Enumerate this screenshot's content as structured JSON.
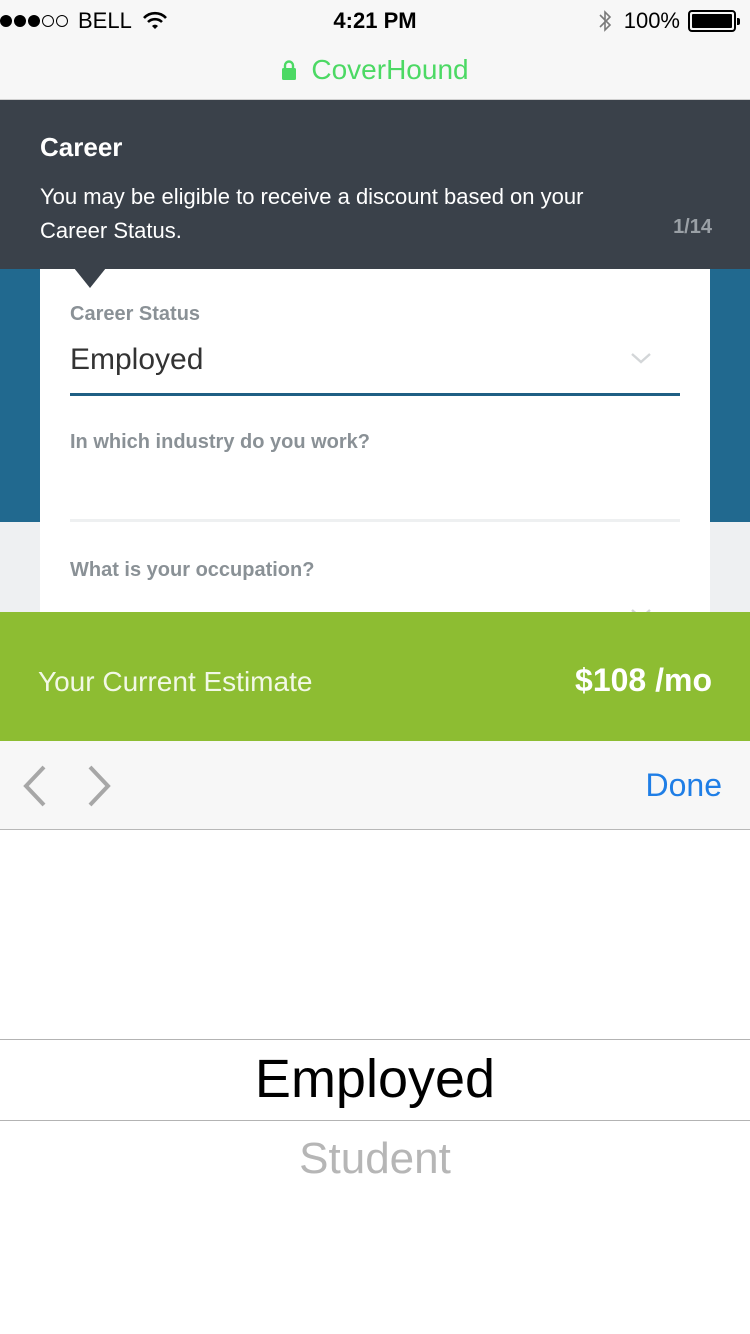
{
  "status_bar": {
    "carrier": "BELL",
    "time": "4:21 PM",
    "battery": "100%",
    "signal_bars": 3
  },
  "browser": {
    "site": "CoverHound",
    "url_color": "#4cd964"
  },
  "tooltip": {
    "title": "Career",
    "body": "You may be eligible to receive a discount based on your Career Status.",
    "step": "1/14"
  },
  "form": {
    "career_status": {
      "label": "Career Status",
      "value": "Employed"
    },
    "industry": {
      "label": "In which industry do you work?",
      "value": ""
    },
    "occupation": {
      "label": "What is your occupation?",
      "value": ""
    }
  },
  "estimate": {
    "label": "Your Current Estimate",
    "value": "$108 /mo",
    "color": "#8dbd32"
  },
  "keyboard_accessory": {
    "done_label": "Done",
    "prev_icon": "chevron-left-icon",
    "next_icon": "chevron-right-icon"
  },
  "picker": {
    "selected": "Employed",
    "next": "Student"
  },
  "colors": {
    "header_dark": "#3a414a",
    "blue": "#21698f",
    "accent_link": "#1f7ee6"
  }
}
